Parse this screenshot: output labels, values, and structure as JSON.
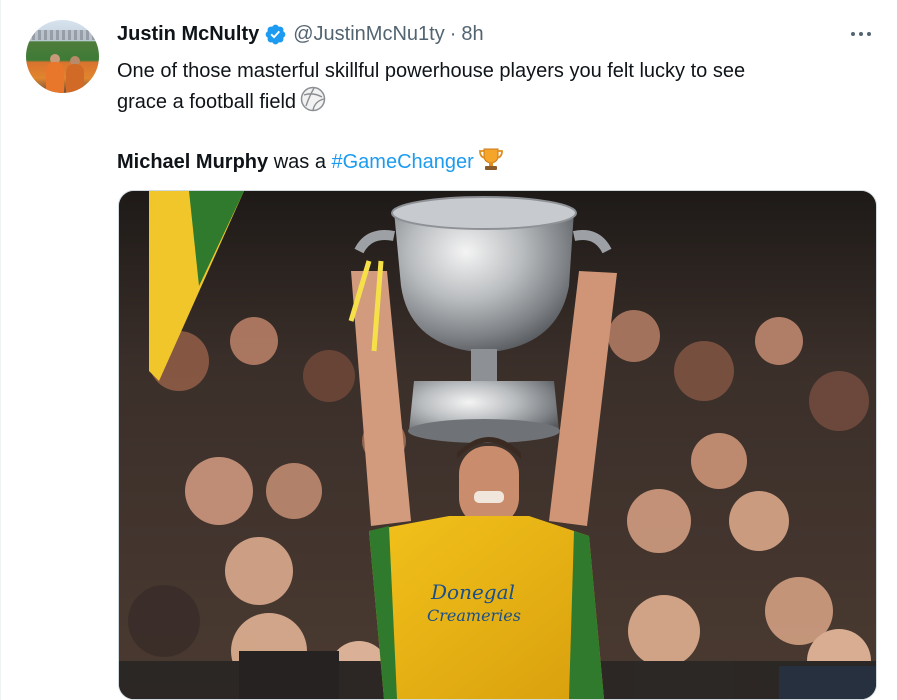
{
  "tweet": {
    "author_name": "Justin McNulty",
    "handle": "@JustinMcNu1ty",
    "separator": "·",
    "time": "8h",
    "text_line1": "One of those masterful skillful powerhouse players you felt lucky to see",
    "text_line2": "grace a football field",
    "mention_name": "Michael Murphy",
    "mention_rest": " was a ",
    "hashtag": "#GameChanger",
    "icons": {
      "verified": "verified-badge-icon",
      "more": "more-options-icon",
      "ball": "football-emoji-icon",
      "trophy": "trophy-emoji-icon"
    },
    "colors": {
      "link": "#1d9bf0",
      "secondary_text": "#536471",
      "verified": "#1d9bf0"
    }
  },
  "media": {
    "jersey_text_line1": "Donegal",
    "jersey_text_line2": "Creameries"
  }
}
